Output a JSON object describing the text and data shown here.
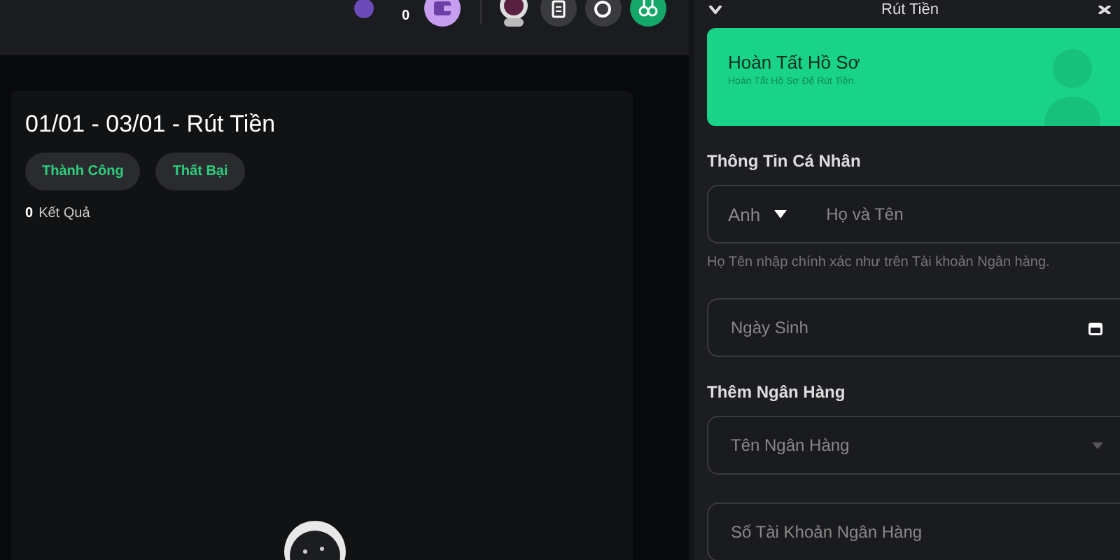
{
  "header": {
    "balance": "0"
  },
  "history": {
    "title": "01/01 - 03/01 - Rút Tiền",
    "filters": [
      {
        "label": "Thành Công",
        "selected": false
      },
      {
        "label": "Thất Bại",
        "selected": false
      }
    ],
    "count": "0",
    "count_label": "Kết Quả"
  },
  "panel": {
    "title": "Rút Tiền",
    "banner": {
      "title": "Hoàn Tất Hồ Sơ",
      "subtitle": "Hoàn Tất Hồ Sơ Để Rút Tiền."
    },
    "sections": [
      {
        "heading": "Thông Tin Cá Nhân",
        "fields": [
          {
            "kind": "name",
            "prefix": "Anh",
            "placeholder": "Họ và Tên",
            "hint": "Họ Tên nhập chính xác như trên Tài khoản Ngân hàng."
          },
          {
            "kind": "date",
            "placeholder": "Ngày Sinh"
          }
        ]
      },
      {
        "heading": "Thêm Ngân Hàng",
        "fields": [
          {
            "kind": "select",
            "placeholder": "Tên Ngân Hàng"
          },
          {
            "kind": "text",
            "placeholder": "Số Tài Khoản Ngân Hàng"
          }
        ]
      }
    ]
  }
}
